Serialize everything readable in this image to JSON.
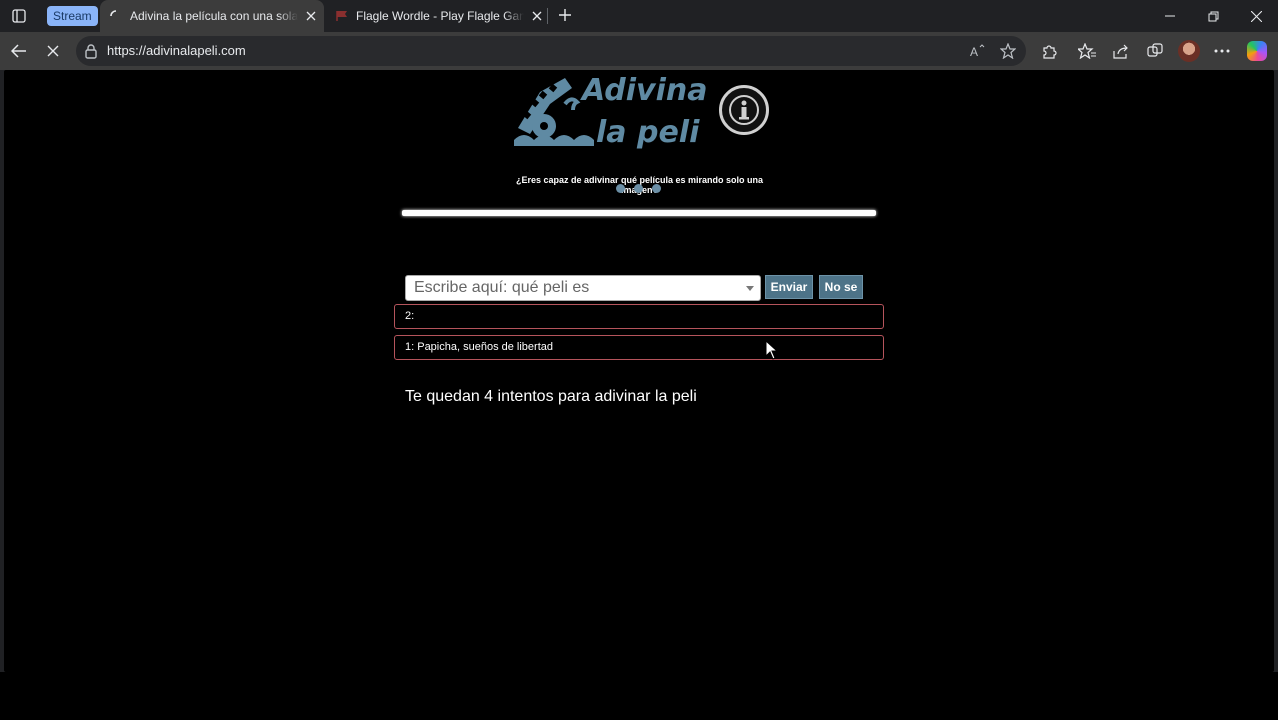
{
  "browser": {
    "stream_badge": "Stream",
    "tabs": [
      {
        "title": "Adivina la película con una sola imagen",
        "active": true
      },
      {
        "title": "Flagle Wordle - Play Flagle Game",
        "active": false
      }
    ],
    "url": "https://adivinalapeli.com"
  },
  "page": {
    "logo_line1": "Adivina",
    "logo_line2": "la peli",
    "subtitle": "¿Eres capaz de adivinar qué película es mirando solo una imagen?",
    "progress_fraction": 1.0,
    "search": {
      "placeholder": "Escribe aquí: qué peli es",
      "value": ""
    },
    "buttons": {
      "submit": "Enviar",
      "skip": "No se"
    },
    "attempts": [
      {
        "label": "2:"
      },
      {
        "label": "1: Papicha, sueños de libertad"
      }
    ],
    "remaining_text": "Te quedan 4 intentos para adivinar la peli"
  },
  "colors": {
    "accent": "#4d7388",
    "logo": "#5f8aa3",
    "attempt_border": "#b5545c",
    "background": "#000000"
  },
  "icons": [
    "tab-actions-icon",
    "loading-icon",
    "flag-icon",
    "close-icon",
    "plus-icon",
    "minimize-icon",
    "restore-icon",
    "back-arrow-icon",
    "stop-icon",
    "lock-icon",
    "read-aloud-icon",
    "favorite-star-icon",
    "extensions-icon",
    "favorites-icon",
    "share-icon",
    "collections-icon",
    "more-icon",
    "copilot-icon",
    "info-icon",
    "cursor-icon"
  ]
}
